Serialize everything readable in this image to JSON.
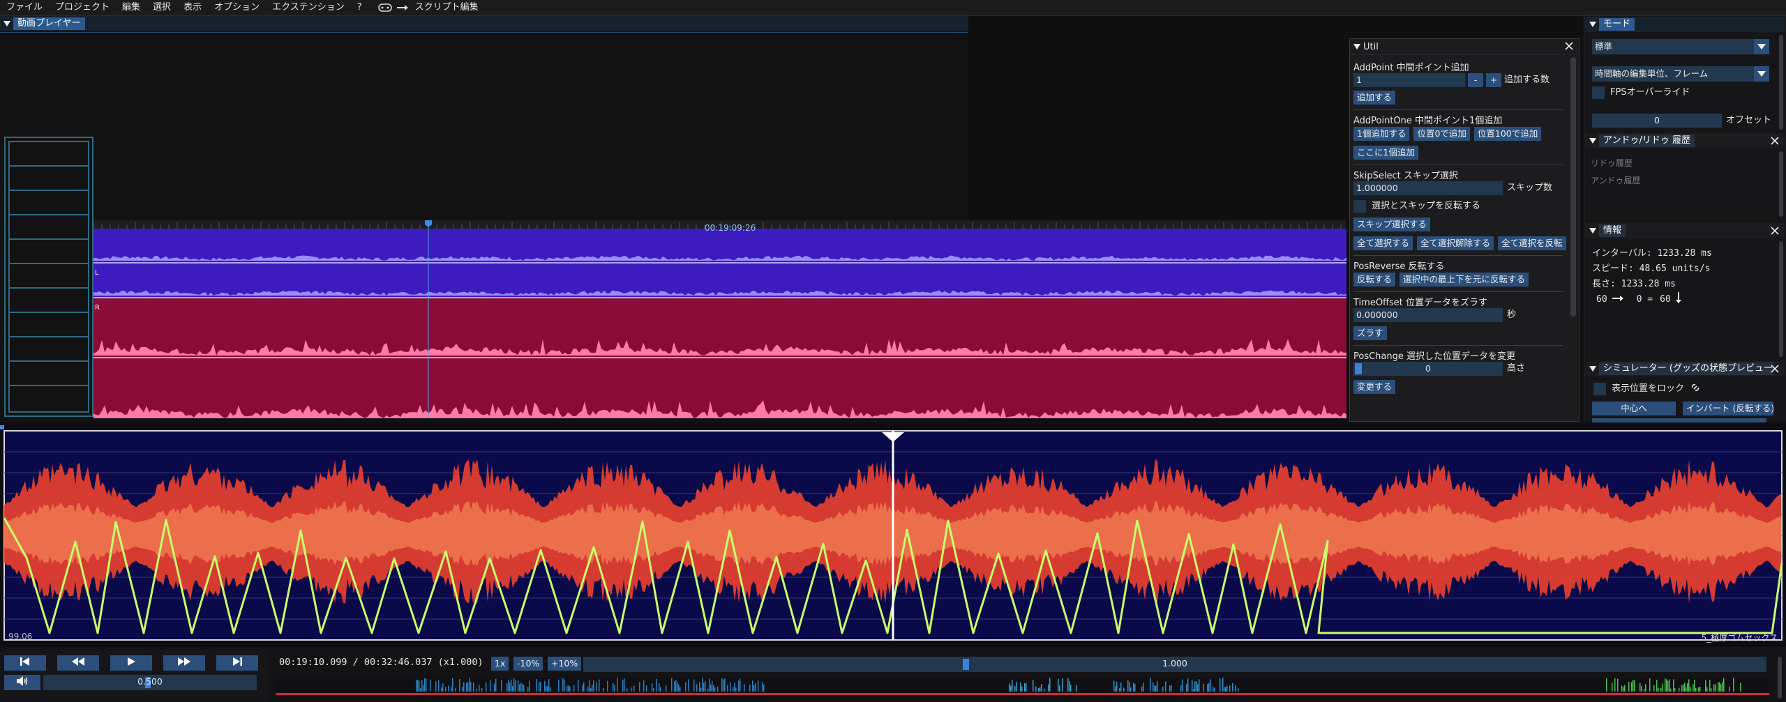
{
  "menu": {
    "items": [
      "ファイル",
      "プロジェクト",
      "編集",
      "選択",
      "表示",
      "オプション",
      "エクステンション",
      "?"
    ],
    "script_label": "スクリプト編集"
  },
  "player": {
    "tab": "動画プレイヤー",
    "timecode": "00:19:09:26"
  },
  "util": {
    "title": "Util",
    "addpoint": {
      "title": "AddPoint 中間ポイント追加",
      "value": "1",
      "minus": "-",
      "plus": "+",
      "count_label": "追加する数",
      "add_button": "追加する"
    },
    "addpointone": {
      "title": "AddPointOne 中間ポイント1個追加",
      "buttons": [
        "1個追加する",
        "位置0で追加",
        "位置100で追加"
      ],
      "here_button": "ここに1個追加"
    },
    "skipselect": {
      "title": "SkipSelect スキップ選択",
      "value": "1.000000",
      "count_label": "スキップ数",
      "invert_label": "選択とスキップを反転する",
      "skip_button": "スキップ選択する",
      "buttons": [
        "全て選択する",
        "全て選択解除する",
        "全て選択を反転"
      ]
    },
    "posreverse": {
      "title": "PosReverse 反転する",
      "buttons": [
        "反転する",
        "選択中の最上下を元に反転する"
      ]
    },
    "timeoffset": {
      "title": "TimeOffset 位置データをズラす",
      "value": "0.000000",
      "unit": "秒",
      "button": "ズラす"
    },
    "poschange": {
      "title": "PosChange 選択した位置データを変更",
      "value": "0",
      "height_label": "高さ",
      "button": "変更する"
    }
  },
  "mode": {
    "title": "モード",
    "select1": "標準",
    "select2": "時間軸の編集単位、フレーム",
    "fps_label": "FPSオーバーライド",
    "offset_value": "0",
    "offset_label": "オフセット"
  },
  "history": {
    "title": "アンドゥ/リドゥ 履歴",
    "redo": "リドゥ履歴",
    "undo": "アンドゥ履歴"
  },
  "info": {
    "title": "情報",
    "interval": "インターバル: 1233.28 ms",
    "speed": "スピード: 48.65 units/s",
    "length": "長さ: 1233.28 ms",
    "pos_from": "60",
    "pos_mid": "0 =",
    "pos_to": "60"
  },
  "simulator": {
    "title": "シミュレーター (グッズの状態プレビュー)",
    "lock_label": "表示位置をロック",
    "center_button": "中心へ",
    "invert_button": "インバート (反転する)"
  },
  "script_view": {
    "left_value": "99.06",
    "right_label": "5_極厚ゴムセックス"
  },
  "transport": {
    "volume": "0.500",
    "time_text": "00:19:10.099 / 00:32:46.037 (x1.000)",
    "speed_buttons": [
      "1x",
      "-10%",
      "+10%"
    ],
    "speed_value": "1.000"
  },
  "colors": {
    "accent": "#2b4f7a",
    "audio_blue": "#3d1cbf",
    "audio_red": "#8a0c36",
    "script_line": "#c8ff6a",
    "heatmap_wave": "#ff5040"
  }
}
